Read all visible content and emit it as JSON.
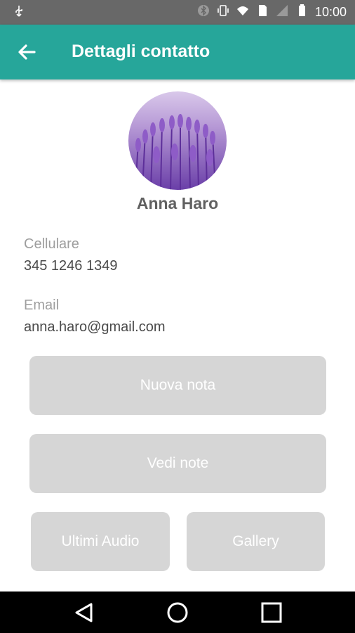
{
  "status_bar": {
    "time": "10:00",
    "icons": [
      "usb-icon",
      "bluetooth-icon",
      "vibrate-icon",
      "wifi-icon",
      "sim-icon",
      "signal-icon",
      "battery-icon"
    ]
  },
  "toolbar": {
    "title": "Dettagli contatto",
    "back_icon": "arrow-back-icon",
    "color": "#26a69a"
  },
  "contact": {
    "name": "Anna Haro",
    "phone_label": "Cellulare",
    "phone": "345 1246 1349",
    "email_label": "Email",
    "email": "anna.haro@gmail.com"
  },
  "actions": {
    "new_note": "Nuova nota",
    "view_notes": "Vedi note",
    "recent_audio": "Ultimi Audio",
    "gallery": "Gallery"
  },
  "nav_bar": {
    "icons": [
      "back-triangle-icon",
      "home-circle-icon",
      "recents-square-icon"
    ]
  }
}
